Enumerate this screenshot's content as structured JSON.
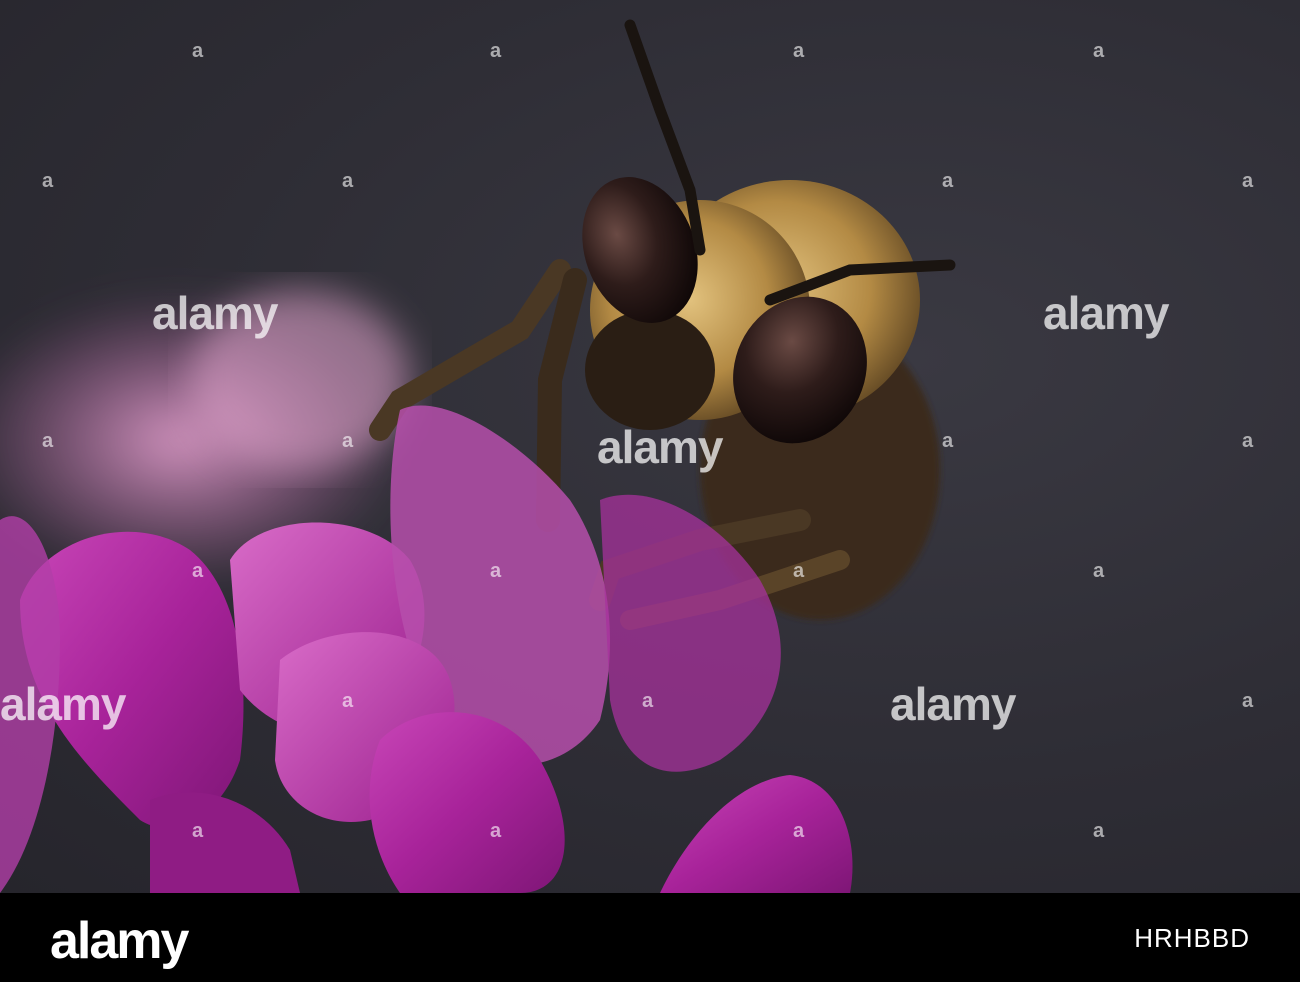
{
  "watermark": {
    "text": "alamy",
    "dot_symbol": "a"
  },
  "footer": {
    "logo": "alamy",
    "image_code": "HRHBBD"
  },
  "colors": {
    "background": "#2e2d35",
    "petal": "#a8239a",
    "bee_fur": "#c9a45a",
    "footer": "#000000"
  }
}
